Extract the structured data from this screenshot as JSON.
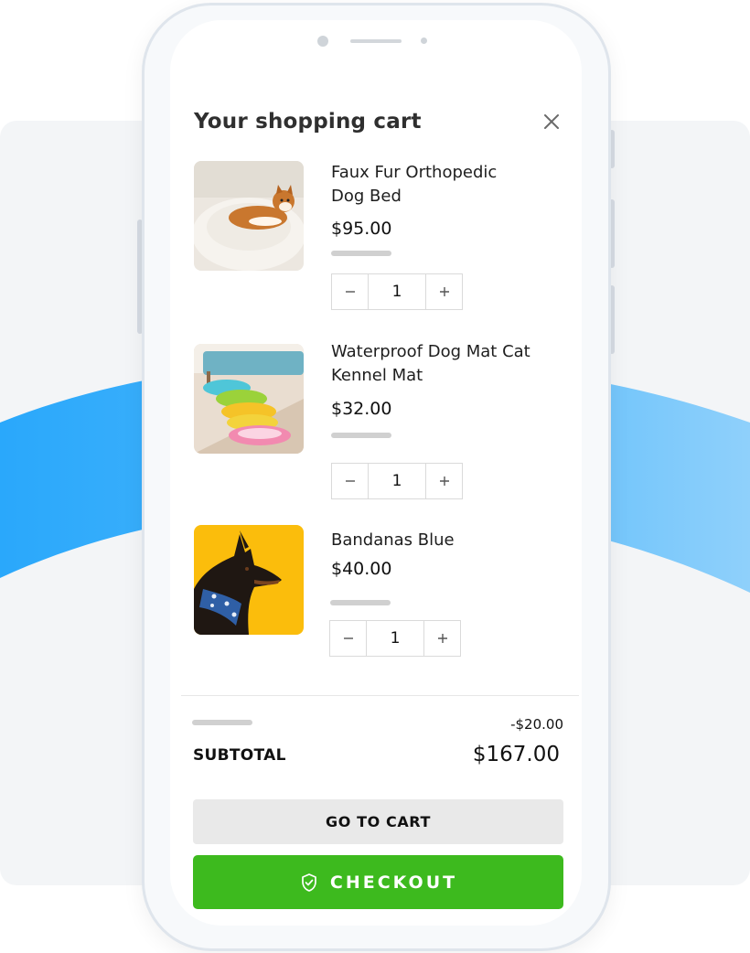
{
  "cart": {
    "title": "Your shopping cart",
    "close_icon": "close-icon"
  },
  "items": [
    {
      "name": "Faux Fur Orthopedic Dog Bed",
      "price": "$95.00",
      "quantity": "1",
      "image": "dog-bed-photo"
    },
    {
      "name": "Waterproof Dog Mat Cat Kennel Mat",
      "price": "$32.00",
      "quantity": "1",
      "image": "pet-mats-photo"
    },
    {
      "name": "Bandanas Blue",
      "price": "$40.00",
      "quantity": "1",
      "image": "dog-bandana-photo"
    }
  ],
  "stepper": {
    "minus_icon": "minus-icon",
    "plus_icon": "plus-icon"
  },
  "summary": {
    "discount": "-$20.00",
    "subtotal_label": "SUBTOTAL",
    "subtotal_value": "$167.00"
  },
  "actions": {
    "go_to_cart_label": "GO TO CART",
    "checkout_label": "CHECKOUT",
    "checkout_icon": "shield-check-icon"
  },
  "colors": {
    "accent_green": "#3dba1e",
    "background_blue": "#2aa8fb",
    "button_gray": "#e9e9e9"
  }
}
